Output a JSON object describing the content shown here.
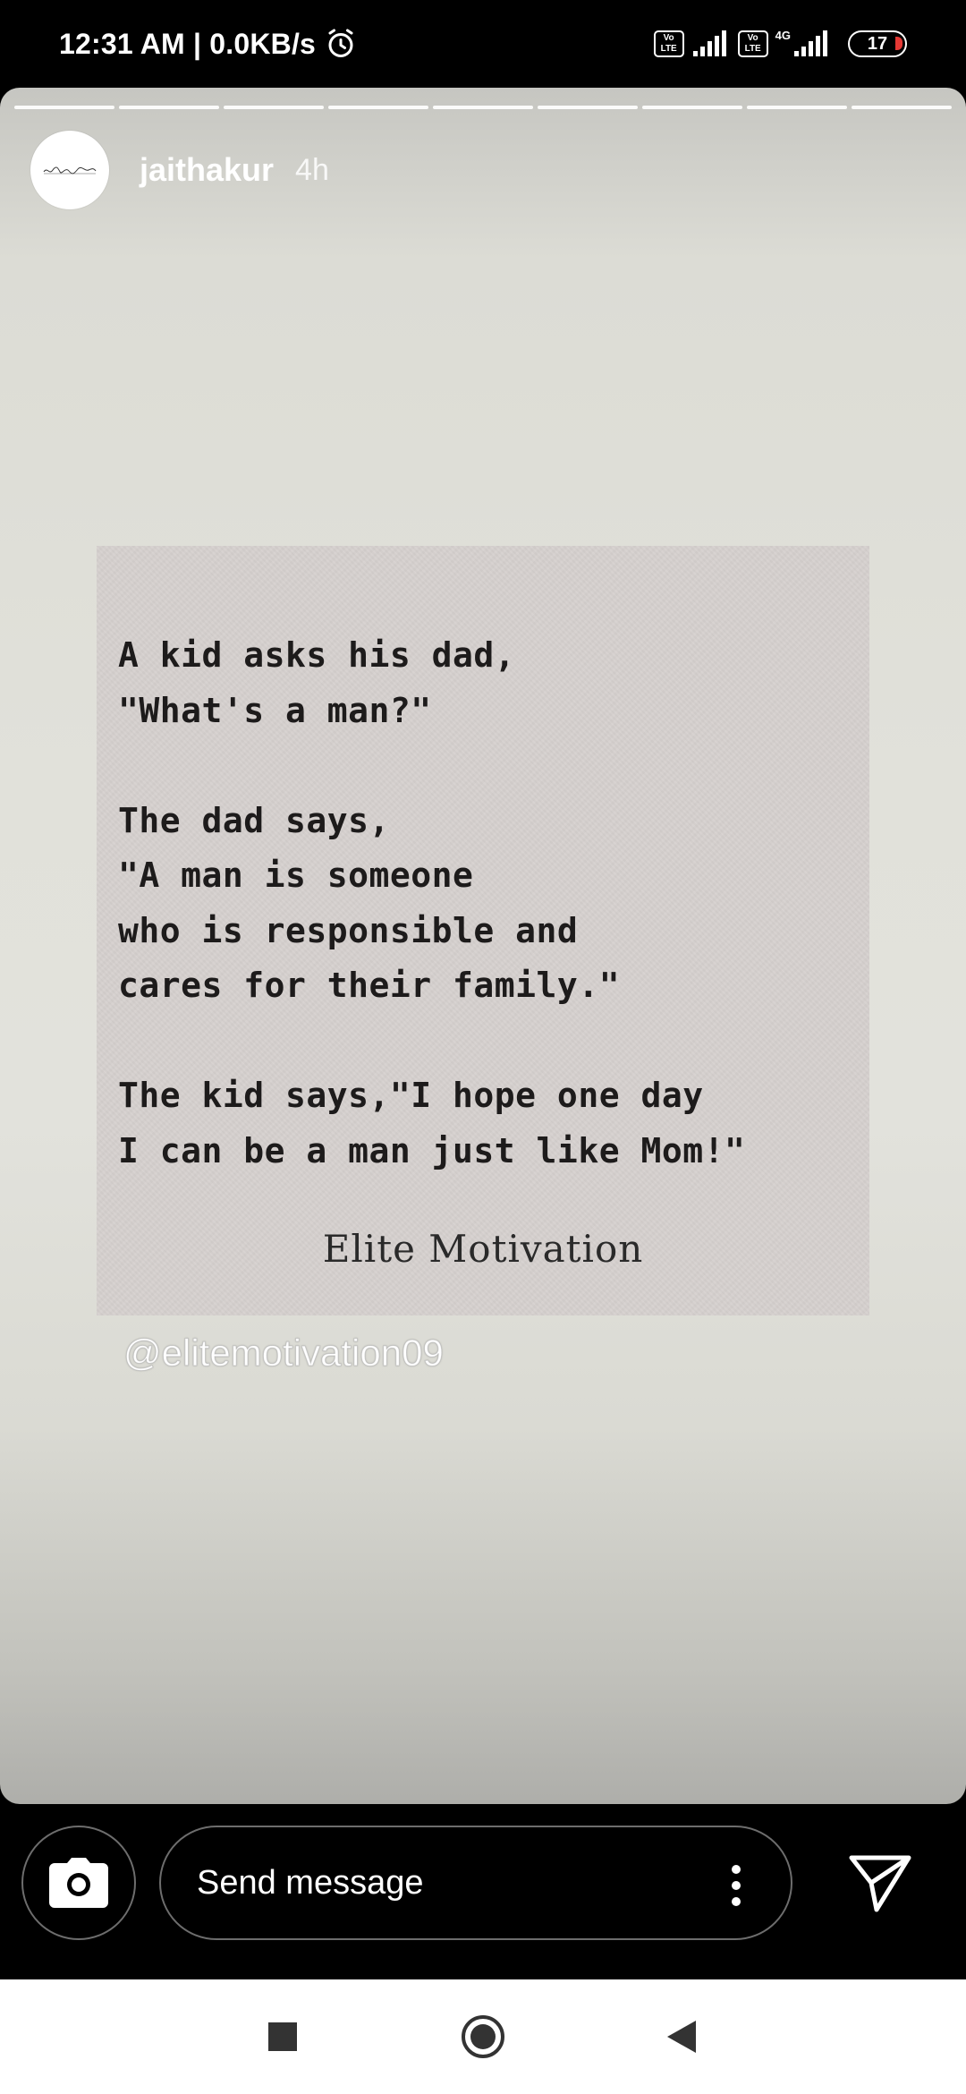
{
  "status_bar": {
    "time": "12:31 AM | 0.0KB/s",
    "volte_label": "Vo LTE",
    "network_type": "4G",
    "battery_level": "17"
  },
  "story": {
    "segment_count": 9,
    "username": "jaithakur",
    "posted_ago": "4h",
    "quote_lines": [
      "A kid asks his dad,",
      "\"What's a man?\"",
      "",
      "The dad says,",
      "\"A man is someone",
      "who is responsible and",
      "cares for their family.\"",
      "",
      "The kid says,\"I hope one day",
      "I can be a man just like Mom!\""
    ],
    "card_signature": "Elite Motivation",
    "mention": "@elitemotivation09"
  },
  "reply_bar": {
    "message_placeholder": "Send message"
  },
  "icons": {
    "alarm": "alarm-clock-icon",
    "signal": "signal-bars-icon",
    "camera": "camera-icon",
    "more": "more-vertical-icon",
    "send": "paper-plane-icon",
    "nav_recents": "square-icon",
    "nav_home": "circle-icon",
    "nav_back": "triangle-back-icon"
  },
  "colors": {
    "battery_low": "#e53935",
    "story_bg": "#e1e1da",
    "card_bg": "#d6d1cf"
  }
}
